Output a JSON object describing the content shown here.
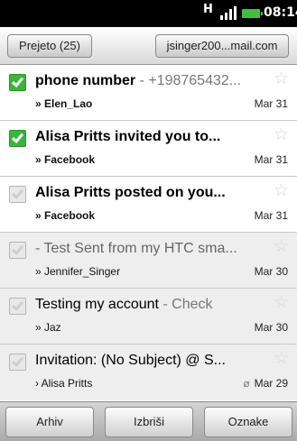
{
  "status_bar": {
    "network": "H",
    "time": "08:14"
  },
  "header": {
    "folder_label": "Prejeto (25)",
    "account_label": "jsinger200...mail.com"
  },
  "messages": [
    {
      "title": "phone number",
      "snippet": " - +198765432...",
      "sender": "» Elen_Lao",
      "date": "Mar 31",
      "checked": true,
      "unread": true,
      "attachment": false
    },
    {
      "title": "Alisa Pritts invited you to...",
      "snippet": "",
      "sender": "» Facebook",
      "date": "Mar 31",
      "checked": true,
      "unread": true,
      "attachment": false
    },
    {
      "title": "Alisa Pritts posted on you...",
      "snippet": "",
      "sender": "» Facebook",
      "date": "Mar 31",
      "checked": false,
      "unread": true,
      "attachment": false
    },
    {
      "title": " - Test Sent from my HTC sma...",
      "snippet": "",
      "sender": "» Jennifer_Singer",
      "date": "Mar 30",
      "checked": false,
      "unread": false,
      "attachment": false
    },
    {
      "title": "Testing my account",
      "snippet": " - Check",
      "sender": "» Jaz",
      "date": "Mar 30",
      "checked": false,
      "unread": false,
      "attachment": false
    },
    {
      "title": "Invitation: (No Subject) @ S...",
      "snippet": "",
      "sender": "› Alisa Pritts",
      "date": "Mar 29",
      "checked": false,
      "unread": false,
      "attachment": true
    }
  ],
  "toolbar": {
    "archive_label": "Arhiv",
    "delete_label": "Izbriši",
    "labels_label": "Oznake"
  },
  "colors": {
    "check_green": "#3cb43c",
    "battery_green": "#3fbf3f"
  },
  "icons": {
    "star": "star-icon",
    "attachment": "paperclip-icon",
    "checkbox": "checkbox-icon"
  }
}
